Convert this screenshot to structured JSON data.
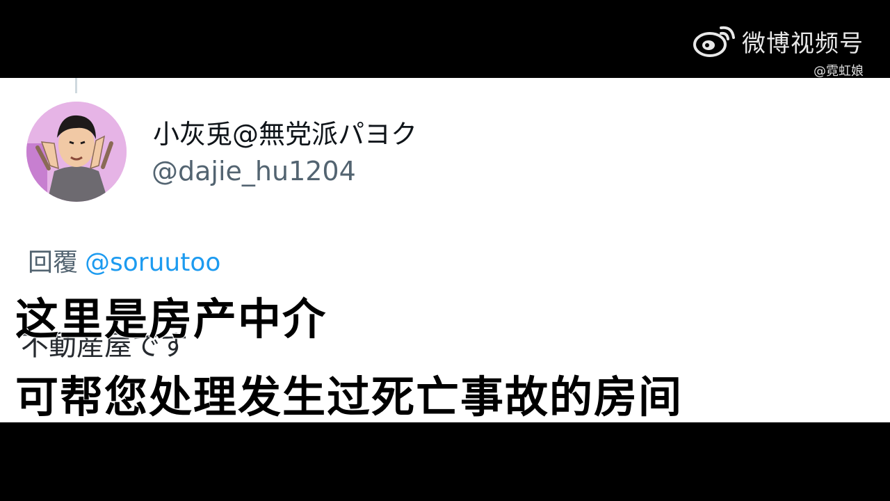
{
  "watermark": {
    "icon": "weibo-eye-logo-icon",
    "title": "微博视频号",
    "user": "@霓虹娘"
  },
  "tweet": {
    "avatar_icon": "user-avatar-peace-sign",
    "display_name": "小灰兎@無党派パヨク",
    "handle": "@dajie_hu1204",
    "reply_label": "回覆",
    "reply_mention": "@soruutoo",
    "partial_body": "不動産屋です"
  },
  "subtitles": {
    "line1": "这里是房产中介",
    "line2": "可帮您处理发生过死亡事故的房间"
  },
  "colors": {
    "background": "#000000",
    "panel": "#ffffff",
    "link_blue": "#1d9bf0",
    "muted_gray": "#536471",
    "avatar_bg": "#e6b4e6"
  }
}
